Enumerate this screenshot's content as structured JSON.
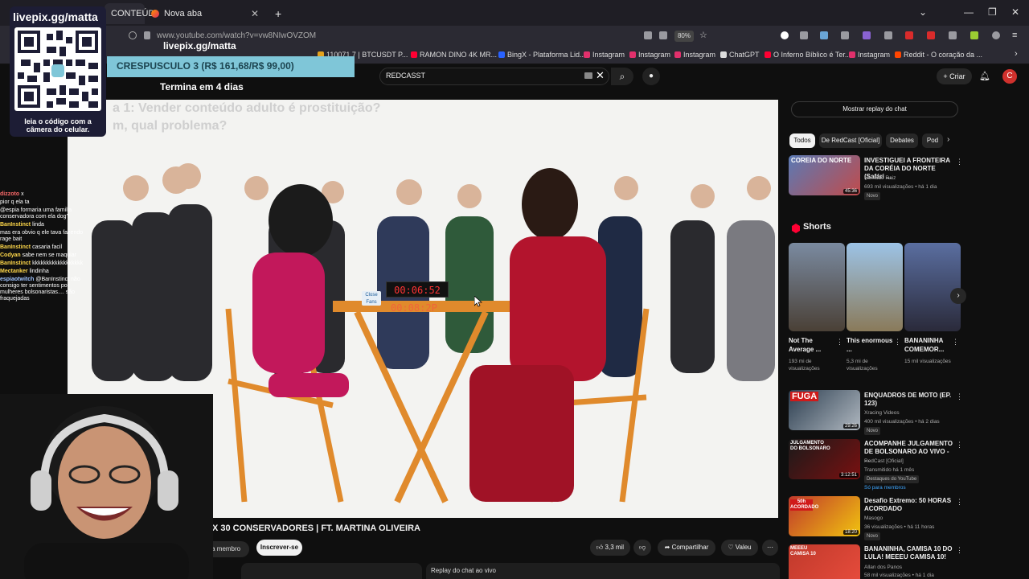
{
  "browser": {
    "tabs": [
      {
        "label": "CONTEÚD",
        "active": true
      },
      {
        "label": "Nova aba",
        "active": false
      }
    ],
    "new_tab": "+",
    "url": "www.youtube.com/watch?v=vw8NIwOVZOM",
    "zoom": "80%",
    "bookmarks": [
      {
        "label": "110071.7 | BTCUSDT P...",
        "color": "#e4a21d"
      },
      {
        "label": "RAMON DINO 4K MR...",
        "color": "#ff0033"
      },
      {
        "label": "BingX - Plataforma Lid...",
        "color": "#2962ff"
      },
      {
        "label": "Instagram",
        "color": "#e1306c"
      },
      {
        "label": "Instagram",
        "color": "#e1306c"
      },
      {
        "label": "Instagram",
        "color": "#e1306c"
      },
      {
        "label": "ChatGPT",
        "color": "#dddddd"
      },
      {
        "label": "O Inferno Bíblico é Ter...",
        "color": "#ff0033"
      },
      {
        "label": "Instagram",
        "color": "#e1306c"
      },
      {
        "label": "Reddit - O coração da ...",
        "color": "#ff4500"
      }
    ]
  },
  "overlay": {
    "qr_title": "livepix.gg/matta",
    "qr_sub": "livepix.gg/matta",
    "qr_caption": "leia o código com a câmera do celular.",
    "promo": "CRESPUSCULO 3 (R$ 161,68/R$ 99,00)",
    "promo_time": "Termina em 4 dias"
  },
  "chat": [
    {
      "user": "dizzoto",
      "text": "x",
      "color": "#ff6b6b"
    },
    {
      "user": "",
      "text": "pior q ela ta",
      "color": "#ff6b6b"
    },
    {
      "user": "",
      "text": "@espia formaria uma familia conservadora com ela dog?",
      "color": "#ff6b6b"
    },
    {
      "user": "BanInstinct",
      "text": "linda",
      "color": "#ffd84a"
    },
    {
      "user": "",
      "text": "mas era obvio q ele tava fazendo rage bait",
      "color": "#ff6b6b"
    },
    {
      "user": "BanInstinct",
      "text": "casaria facil",
      "color": "#ffd84a"
    },
    {
      "user": "Codyan",
      "text": "sabe nem se maquiar",
      "color": "#ffd84a"
    },
    {
      "user": "BanInstinct",
      "text": "kkkkkkkkkkkkkkkkkk",
      "color": "#ffd84a"
    },
    {
      "user": "Mectanker",
      "text": "lindinha",
      "color": "#ffd84a"
    },
    {
      "user": "espiaotwitch",
      "text": "@BanInstinct não consigo ter sentimentos por mulheres bolsonaristas.... são fraquejadas",
      "color": "#a0c4ff"
    }
  ],
  "youtube": {
    "search_value": "REDCASST",
    "criar": "Criar",
    "avatar": "C",
    "video": {
      "question_1": "a 1: Vender conteúdo adulto é prostituição?",
      "question_2": "m, qual problema?",
      "timer": "00:06:52",
      "timer_reflection": "00:08:2P",
      "brand": "Close Fans",
      "title": "X 30 CONSERVADORES | FT. MARTINA OLIVEIRA"
    },
    "actions": {
      "member": "eja membro",
      "subscribe": "Inscrever-se",
      "likes": "3,3 mil",
      "share": "Compartilhar",
      "thanks": "Valeu",
      "more": "⋯"
    },
    "replay_chat_bar": "Replay do chat ao vivo",
    "sidebar": {
      "show_chat": "Mostrar replay do chat",
      "chips": [
        "Todos",
        "De RedCast [Oficial]",
        "Debates",
        "Pod"
      ],
      "videos": [
        {
          "title": "INVESTIGUEI A FRONTEIRA DA CORÉIA DO NORTE (Safári ...",
          "channel": "Nômade Raiz",
          "meta": "693 mil visualizações • há 1 dia",
          "badge": "Novo",
          "duration": "45:36",
          "thumb_text": "COREIA DO NORTE"
        },
        {
          "title": "ENQUADROS DE MOTO (EP. 123)",
          "channel": "Xracing Videos",
          "meta": "400 mil visualizações • há 2 dias",
          "badge": "Novo",
          "duration": "29:26",
          "thumb_text": "FUGA"
        },
        {
          "title": "ACOMPANHE JULGAMENTO DE BOLSONARO AO VIVO - ...",
          "channel": "RedCast [Oficial]",
          "meta": "Transmitido há 1 mês",
          "badge": "Destaques do YouTube",
          "badge2": "Só para membros",
          "duration": "3:12:51",
          "thumb_text": "JULGAMENTO DO BOLSONARO"
        },
        {
          "title": "Desafio Extremo: 50 HORAS ACORDADO",
          "channel": "Masogo",
          "meta": "36 visualizações • há 11 horas",
          "badge": "Novo",
          "duration": "18:20",
          "thumb_text": "50h ACORDADO"
        },
        {
          "title": "BANANINHA, CAMISA 10 DO LULA! MEEEU CAMISA 10!",
          "channel": "Allan dos Panos",
          "meta": "58 mil visualizações • há 1 dia",
          "badge": "",
          "duration": "",
          "thumb_text": "MEEEU CAMISA 10"
        }
      ],
      "shorts_heading": "Shorts",
      "shorts": [
        {
          "title": "Not The Average ...",
          "meta": "193 mi de visualizações"
        },
        {
          "title": "This enormous ...",
          "meta": "5,3 mi de visualizações"
        },
        {
          "title": "BANANINHA COMEMOR...",
          "meta": "15 mil visualizações"
        }
      ]
    }
  }
}
